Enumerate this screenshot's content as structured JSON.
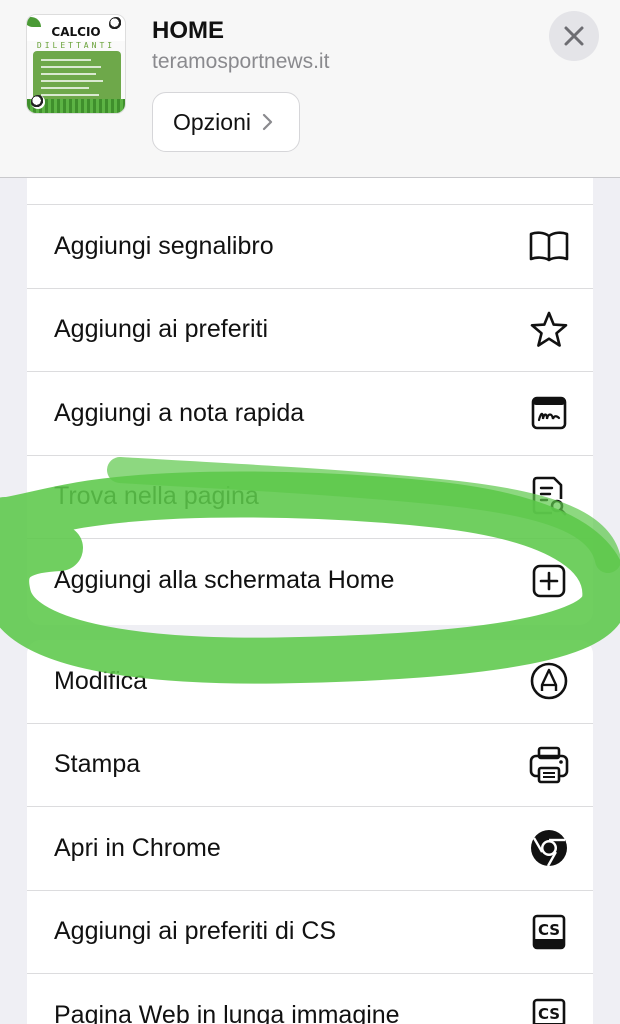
{
  "header": {
    "title": "HOME",
    "url": "teramosportnews.it",
    "options_label": "Opzioni",
    "thumbnail_text_1": "CALCIO",
    "thumbnail_text_2": "DILETTANTI"
  },
  "menu_group_1": [
    {
      "label": "Aggiungi segnalibro",
      "icon": "book-icon"
    },
    {
      "label": "Aggiungi ai preferiti",
      "icon": "star-icon"
    },
    {
      "label": "Aggiungi a nota rapida",
      "icon": "quick-note-icon"
    },
    {
      "label": "Trova nella pagina",
      "icon": "find-in-page-icon"
    },
    {
      "label": "Aggiungi alla schermata Home",
      "icon": "add-square-icon"
    }
  ],
  "menu_group_2": [
    {
      "label": "Modifica",
      "icon": "markup-pen-icon"
    },
    {
      "label": "Stampa",
      "icon": "printer-icon"
    },
    {
      "label": "Apri in Chrome",
      "icon": "chrome-icon"
    },
    {
      "label": "Aggiungi ai preferiti di CS",
      "icon": "cs-icon"
    },
    {
      "label": "Pagina Web in lunga immagine",
      "icon": "cs-icon"
    }
  ],
  "colors": {
    "highlight": "#5cc84a",
    "secondary_text": "#8a8a8e",
    "background": "#efeff4"
  }
}
